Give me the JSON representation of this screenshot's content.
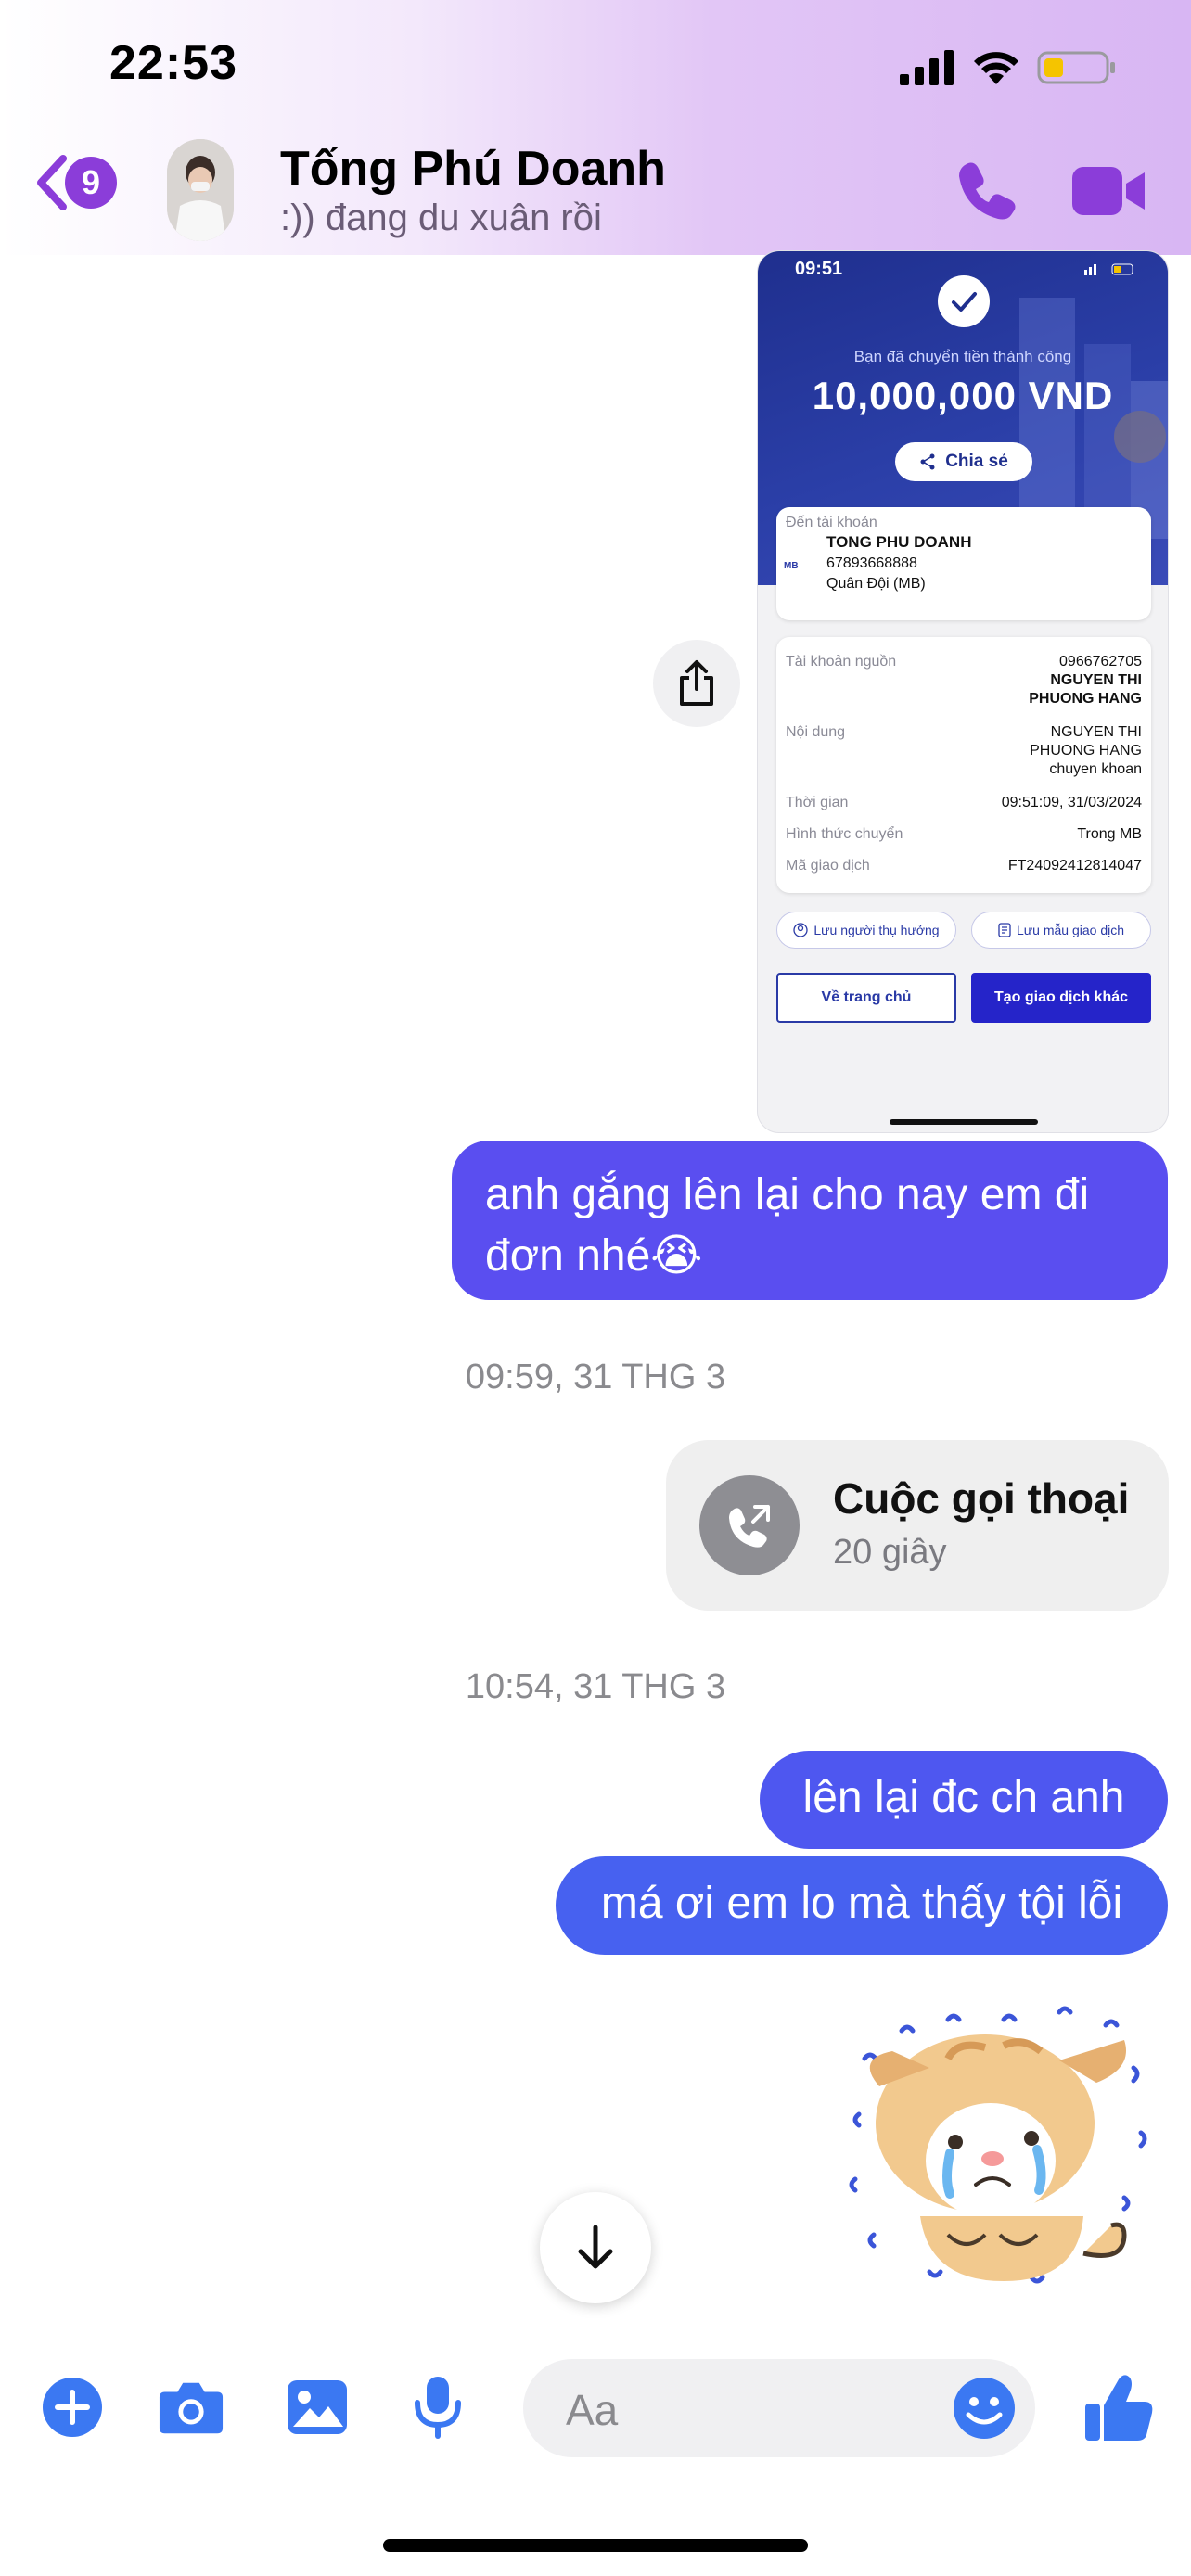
{
  "status_bar": {
    "time": "22:53"
  },
  "header": {
    "back_badge": "9",
    "contact_name": "Tống Phú Doanh",
    "contact_status": ":)) đang du xuân rồi",
    "icons": [
      "back-chevron-icon",
      "phone-icon",
      "video-camera-icon"
    ],
    "accent_color": "#8b3dd9"
  },
  "receipt": {
    "time": "09:51",
    "success_text": "Bạn đã chuyển tiền thành công",
    "amount": "10,000,000 VND",
    "share_label": "Chia sẻ",
    "to_account_label": "Đến tài khoản",
    "to_name": "TONG PHU DOANH",
    "bank_logo": "MB",
    "to_account_number": "67893668888",
    "to_bank": "Quân Đội (MB)",
    "rows": [
      {
        "label": "Tài khoản nguồn",
        "value_lines": [
          "0966762705",
          "NGUYEN THI",
          "PHUONG HANG"
        ]
      },
      {
        "label": "Nội dung",
        "value_lines": [
          "NGUYEN THI",
          "PHUONG HANG",
          "chuyen khoan"
        ]
      },
      {
        "label": "Thời gian",
        "value_lines": [
          "09:51:09, 31/03/2024"
        ]
      },
      {
        "label": "Hình thức chuyển",
        "value_lines": [
          "Trong MB"
        ]
      },
      {
        "label": "Mã giao dịch",
        "value_lines": [
          "FT24092412814047"
        ]
      }
    ],
    "save_beneficiary": "Lưu người thụ hưởng",
    "save_template": "Lưu mẫu giao dịch",
    "home_button": "Về trang chủ",
    "new_transaction_button": "Tạo giao dịch khác"
  },
  "messages": [
    {
      "type": "text",
      "text": "anh gắng lên lại cho nay em đi đơn nhé😭"
    },
    {
      "type": "timestamp",
      "text": "09:59, 31 THG 3"
    },
    {
      "type": "call",
      "title": "Cuộc gọi thoại",
      "duration": "20 giây"
    },
    {
      "type": "timestamp",
      "text": "10:54, 31 THG 3"
    },
    {
      "type": "text",
      "text": "lên lại đc ch anh"
    },
    {
      "type": "text",
      "text": "má ơi em lo mà thấy tội lỗi"
    },
    {
      "type": "sticker",
      "name": "crying-cat-sticker"
    }
  ],
  "composer": {
    "placeholder": "Aa",
    "icons": [
      "plus-icon",
      "camera-icon",
      "image-icon",
      "microphone-icon",
      "emoji-icon",
      "thumbs-up-icon"
    ]
  },
  "colors": {
    "bubble_blue": "#4e57f0",
    "bubble_purple": "#5a4ef0",
    "messenger_blue": "#3b78f2"
  }
}
